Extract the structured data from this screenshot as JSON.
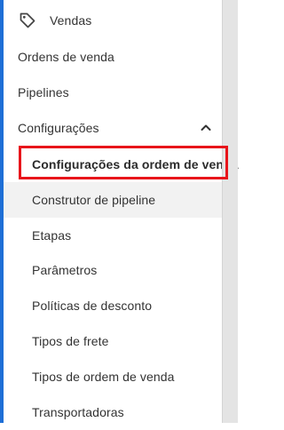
{
  "nav": {
    "section_title": "Vendas",
    "section_icon": "tag-icon",
    "items": [
      {
        "label": "Ordens de venda"
      },
      {
        "label": "Pipelines"
      },
      {
        "label": "Configurações",
        "icon": "chevron-up-icon"
      }
    ],
    "sub_items": [
      {
        "label": "Configurações da ordem de venda",
        "state": "selected"
      },
      {
        "label": "Construtor de pipeline",
        "state": "hover"
      },
      {
        "label": "Etapas"
      },
      {
        "label": "Parâmetros"
      },
      {
        "label": "Políticas de desconto"
      },
      {
        "label": "Tipos de frete"
      },
      {
        "label": "Tipos de ordem de venda"
      },
      {
        "label": "Transportadoras"
      }
    ]
  },
  "colors": {
    "accent": "#1e6fd6",
    "highlight": "#e8151b",
    "hover_background": "#f2f2f2",
    "text": "#333333"
  }
}
